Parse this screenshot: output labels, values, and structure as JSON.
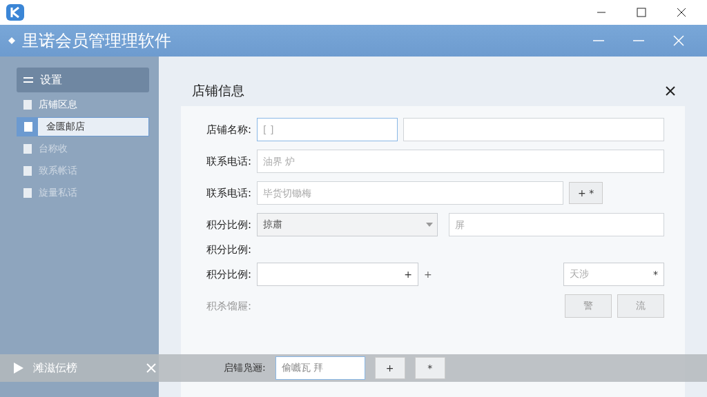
{
  "window": {
    "title": "里诺会员管理理软件"
  },
  "sidebar": {
    "header": "设置",
    "items": [
      {
        "label": "店铺区息",
        "selected": false,
        "disabled": false
      },
      {
        "label": "金匮邮店",
        "selected": true,
        "disabled": false
      },
      {
        "label": "台称收",
        "selected": false,
        "disabled": true
      },
      {
        "label": "致系帐话",
        "selected": false,
        "disabled": true
      },
      {
        "label": "旋量私话",
        "selected": false,
        "disabled": true
      }
    ]
  },
  "dialog": {
    "title": "店铺信息",
    "rows": [
      {
        "kind": "double",
        "label": "店铺名称:",
        "placeholder": "[ ]"
      },
      {
        "kind": "input",
        "label": "联系电话:",
        "placeholder": "油界 炉"
      },
      {
        "kind": "input_button",
        "label": "联系电话:",
        "placeholder": "毕货切锄梅",
        "button": "+ *"
      },
      {
        "kind": "select_input",
        "label": "积分比例:",
        "value": "掠肅",
        "placeholder": "屏"
      },
      {
        "kind": "label",
        "label": "积分比例:"
      },
      {
        "kind": "spin",
        "label": "积分比例:",
        "plus": "+",
        "outside": "+",
        "placeholder": "天涉",
        "star": "*"
      },
      {
        "kind": "buttons",
        "label": "积杀馏屜:",
        "disabled": true,
        "buttons": [
          "警",
          "流"
        ]
      }
    ]
  },
  "overlay": {
    "title": "滩滋伝榜",
    "label": "启锚凫逦:",
    "value": "偷嚱瓦 拜",
    "plus": "+",
    "star": "*"
  }
}
